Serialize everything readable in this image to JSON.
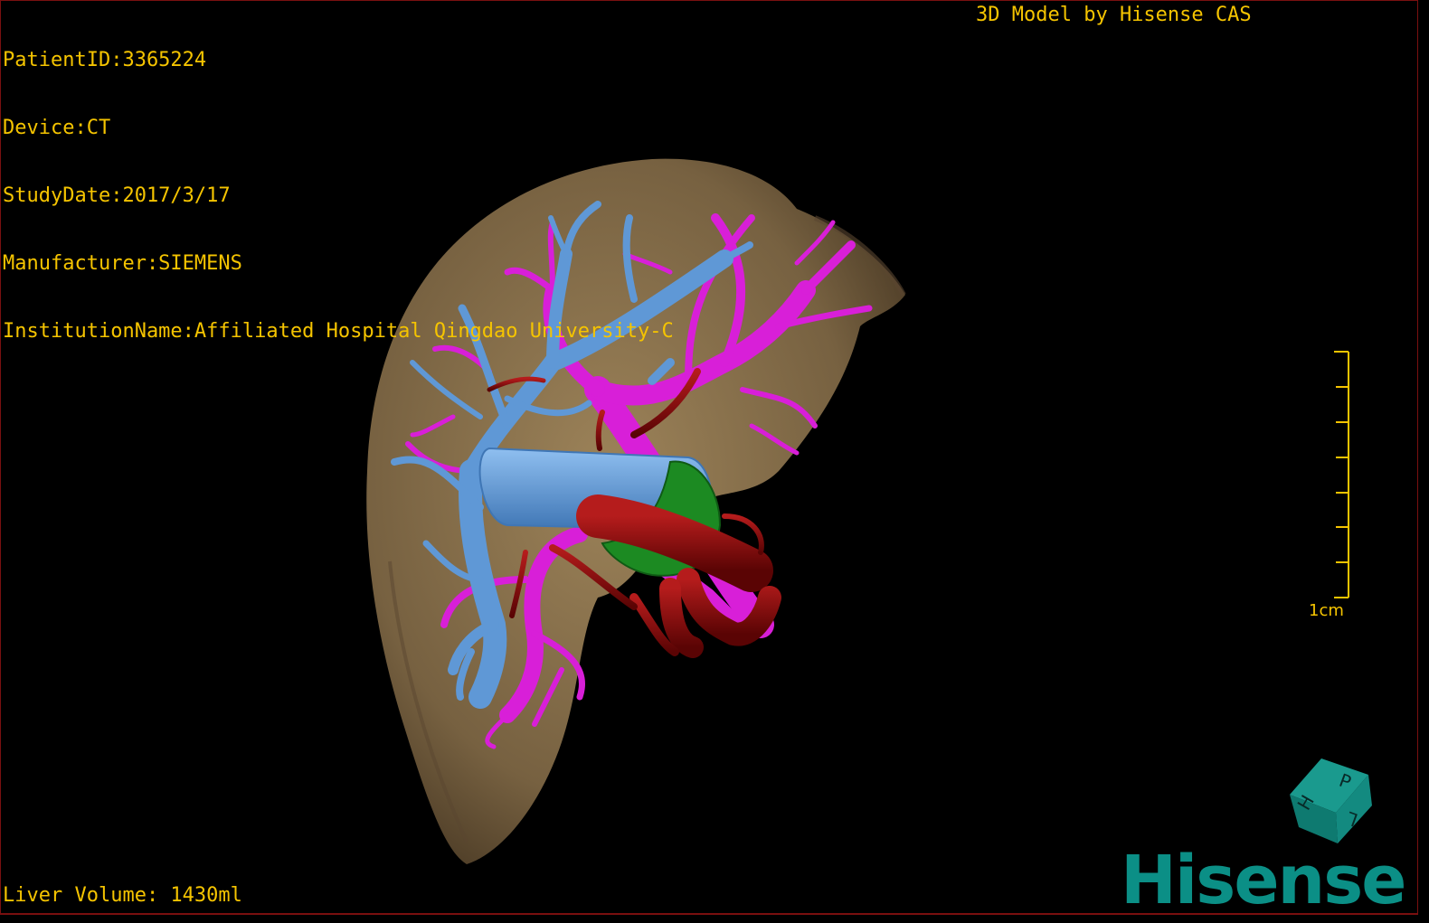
{
  "patient_info": {
    "patient_id": "PatientID:3365224",
    "device": "Device:CT",
    "study_date": "StudyDate:2017/3/17",
    "manufacturer": "Manufacturer:SIEMENS",
    "institution": "InstitutionName:Affiliated Hospital Qingdao University-C"
  },
  "model_credit": "3D Model by Hisense CAS",
  "liver_volume": "Liver Volume: 1430ml",
  "scale_bar": {
    "label": "1cm",
    "ticks": 8
  },
  "orientation_cube": {
    "faces": [
      "H",
      "P",
      "L"
    ]
  },
  "brand_logo": "Hisense",
  "colors": {
    "overlay_text": "#f5c400",
    "liver": "#8a7350",
    "portal_vein": "#d81fd8",
    "hepatic_vein": "#5f98d6",
    "artery": "#8b0a0a",
    "gallbladder": "#1c8a22",
    "brand": "#0b8f86"
  }
}
